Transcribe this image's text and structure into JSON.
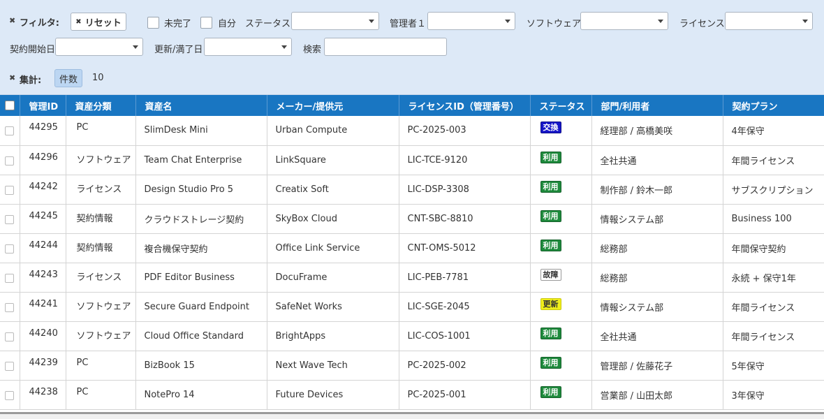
{
  "filters": {
    "toggle_icon": "x-icon",
    "title": "フィルタ:",
    "reset_label": "リセット",
    "incomplete_label": "未完了",
    "mine_label": "自分",
    "status_label": "ステータス",
    "manager_label": "管理者１",
    "software_label": "ソフトウェア",
    "license_label": "ライセンス",
    "contract_start_label": "契約開始日",
    "renewal_label": "更新/満了日",
    "search_label": "検索",
    "search_value": ""
  },
  "summary": {
    "title": "集計:",
    "count_label": "件数",
    "count_value": "10"
  },
  "table": {
    "columns": [
      "管理ID",
      "資産分類",
      "資産名",
      "メーカー/提供元",
      "ライセンスID（管理番号）",
      "ステータス",
      "部門/利用者",
      "契約プラン"
    ],
    "rows": [
      {
        "id": "44295",
        "category": "PC",
        "name": "SlimDesk Mini",
        "maker": "Urban Compute",
        "license_id": "PC-2025-003",
        "status": "交換",
        "status_type": "exchange",
        "dept": "経理部 / 高橋美咲",
        "plan": "4年保守"
      },
      {
        "id": "44296",
        "category": "ソフトウェア",
        "name": "Team Chat Enterprise",
        "maker": "LinkSquare",
        "license_id": "LIC-TCE-9120",
        "status": "利用",
        "status_type": "use",
        "dept": "全社共通",
        "plan": "年間ライセンス"
      },
      {
        "id": "44242",
        "category": "ライセンス",
        "name": "Design Studio Pro 5",
        "maker": "Creatix Soft",
        "license_id": "LIC-DSP-3308",
        "status": "利用",
        "status_type": "use",
        "dept": "制作部 / 鈴木一郎",
        "plan": "サブスクリプション"
      },
      {
        "id": "44245",
        "category": "契約情報",
        "name": "クラウドストレージ契約",
        "maker": "SkyBox Cloud",
        "license_id": "CNT-SBC-8810",
        "status": "利用",
        "status_type": "use",
        "dept": "情報システム部",
        "plan": "Business 100"
      },
      {
        "id": "44244",
        "category": "契約情報",
        "name": "複合機保守契約",
        "maker": "Office Link Service",
        "license_id": "CNT-OMS-5012",
        "status": "利用",
        "status_type": "use",
        "dept": "総務部",
        "plan": "年間保守契約"
      },
      {
        "id": "44243",
        "category": "ライセンス",
        "name": "PDF Editor Business",
        "maker": "DocuFrame",
        "license_id": "LIC-PEB-7781",
        "status": "故障",
        "status_type": "fault",
        "dept": "総務部",
        "plan": "永続 + 保守1年"
      },
      {
        "id": "44241",
        "category": "ソフトウェア",
        "name": "Secure Guard Endpoint",
        "maker": "SafeNet Works",
        "license_id": "LIC-SGE-2045",
        "status": "更新",
        "status_type": "renew",
        "dept": "情報システム部",
        "plan": "年間ライセンス"
      },
      {
        "id": "44240",
        "category": "ソフトウェア",
        "name": "Cloud Office Standard",
        "maker": "BrightApps",
        "license_id": "LIC-COS-1001",
        "status": "利用",
        "status_type": "use",
        "dept": "全社共通",
        "plan": "年間ライセンス"
      },
      {
        "id": "44239",
        "category": "PC",
        "name": "BizBook 15",
        "maker": "Next Wave Tech",
        "license_id": "PC-2025-002",
        "status": "利用",
        "status_type": "use",
        "dept": "管理部 / 佐藤花子",
        "plan": "5年保守"
      },
      {
        "id": "44238",
        "category": "PC",
        "name": "NotePro 14",
        "maker": "Future Devices",
        "license_id": "PC-2025-001",
        "status": "利用",
        "status_type": "use",
        "dept": "営業部 / 山田太郎",
        "plan": "3年保守"
      }
    ]
  },
  "colors": {
    "header_bg": "#1976c2",
    "filter_bg": "#dde9f7",
    "status_exchange": "#1616c8",
    "status_use": "#1e8a3c",
    "status_renew": "#f0ee1a"
  }
}
